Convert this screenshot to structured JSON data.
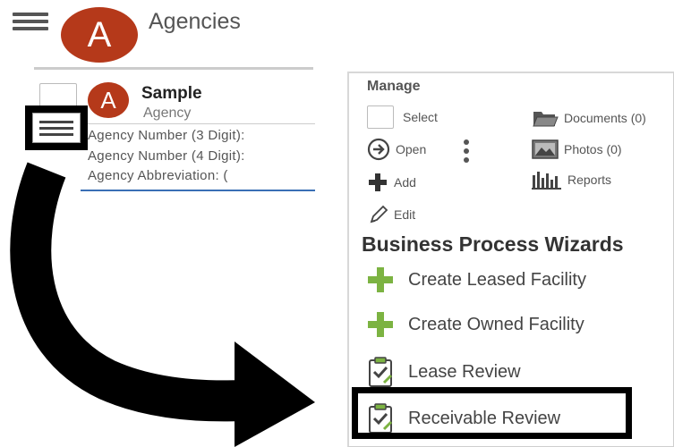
{
  "header": {
    "title": "Agencies",
    "avatar_letter": "A"
  },
  "agency_row": {
    "avatar_letter": "A",
    "name": "Sample",
    "type": "Agency",
    "details": [
      "Agency Number (3 Digit):",
      "Agency Number (4 Digit):",
      "Agency Abbreviation: ("
    ]
  },
  "panel": {
    "manage_label": "Manage",
    "actions": {
      "select": "Select",
      "open": "Open",
      "add": "Add",
      "edit": "Edit",
      "documents": "Documents (0)",
      "photos": "Photos (0)",
      "reports": "Reports"
    },
    "wizards_title": "Business Process Wizards",
    "wizards": [
      {
        "label": "Create Leased Facility",
        "icon": "plus-icon"
      },
      {
        "label": "Create Owned Facility",
        "icon": "plus-icon"
      },
      {
        "label": "Lease Review",
        "icon": "clipboard-check-icon"
      },
      {
        "label": "Receivable Review",
        "icon": "clipboard-check-icon"
      }
    ]
  },
  "colors": {
    "avatar": "#b5391a",
    "plus_green": "#7cb342",
    "accent_blue": "#3a6fb5"
  }
}
